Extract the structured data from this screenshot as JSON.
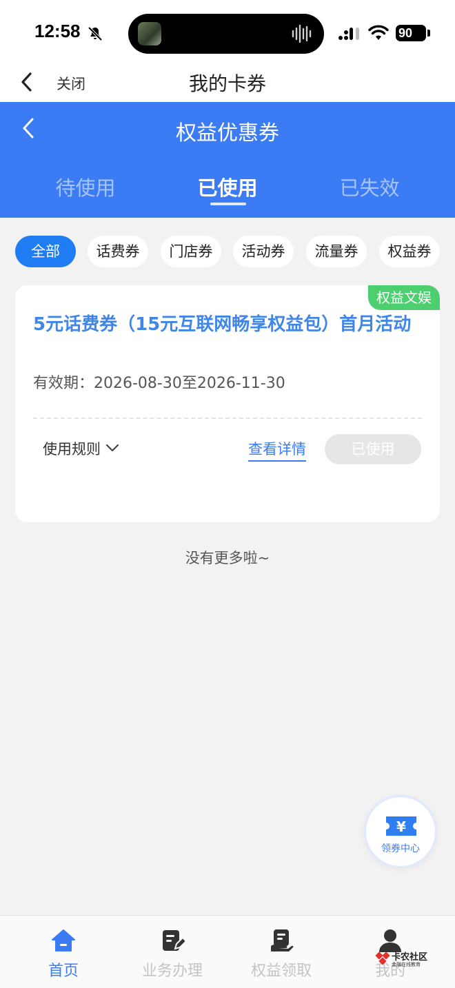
{
  "status_bar": {
    "time": "12:58",
    "battery": "90"
  },
  "nav": {
    "close_label": "关闭",
    "title": "我的卡券"
  },
  "header": {
    "title": "权益优惠券"
  },
  "tabs": [
    {
      "label": "待使用"
    },
    {
      "label": "已使用"
    },
    {
      "label": "已失效"
    }
  ],
  "active_tab": "已使用",
  "chips": [
    {
      "label": "全部"
    },
    {
      "label": "话费券"
    },
    {
      "label": "门店券"
    },
    {
      "label": "活动券"
    },
    {
      "label": "流量券"
    },
    {
      "label": "权益券"
    }
  ],
  "active_chip": "全部",
  "coupon": {
    "tag": "权益文娱",
    "title": "5元话费券（15元互联网畅享权益包）首月活动",
    "validity": "有效期：2026-08-30至2026-11-30",
    "rules_label": "使用规则",
    "detail_label": "查看详情",
    "status_label": "已使用"
  },
  "no_more": "没有更多啦~",
  "fab": {
    "label": "领券中心",
    "symbol": "¥"
  },
  "tabbar": [
    {
      "label": "首页",
      "icon": "home-icon"
    },
    {
      "label": "业务办理",
      "icon": "edit-doc-icon"
    },
    {
      "label": "权益领取",
      "icon": "receive-icon"
    },
    {
      "label": "我的",
      "icon": "user-icon"
    }
  ],
  "watermark": {
    "title": "卡农社区",
    "subtitle": "金融在线教育"
  },
  "colors": {
    "brand_blue": "#3b7cf4",
    "chip_active": "#1f7cf2",
    "tag_green": "#4cd06f",
    "coupon_title": "#3f86e6"
  }
}
